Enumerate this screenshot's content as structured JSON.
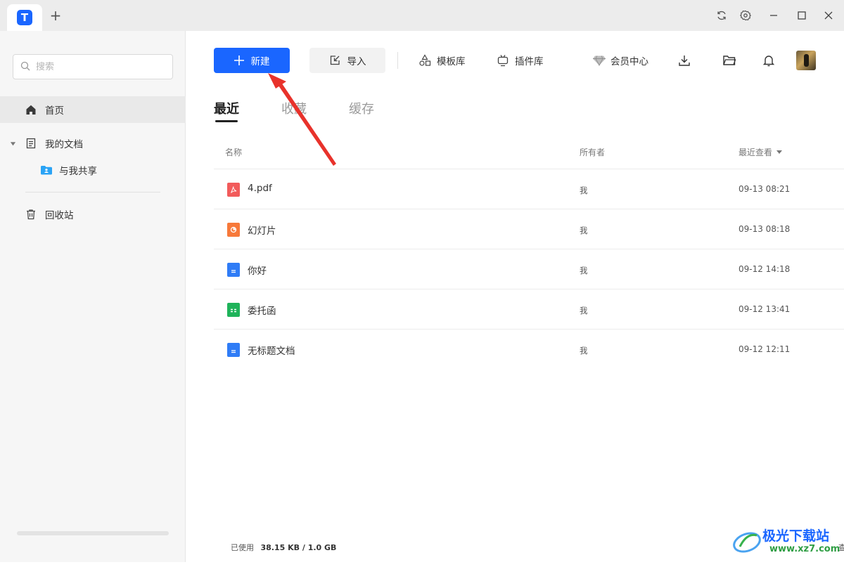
{
  "titlebar": {
    "app_logo_glyph": "T",
    "new_tab": "+"
  },
  "sidebar": {
    "search_placeholder": "搜索",
    "items": [
      {
        "label": "首页",
        "icon": "home-icon",
        "active": true
      },
      {
        "label": "我的文档",
        "icon": "document-icon",
        "expanded": true
      },
      {
        "label": "与我共享",
        "icon": "shared-folder-icon"
      },
      {
        "label": "回收站",
        "icon": "trash-icon"
      }
    ],
    "storage": {
      "label": "已使用",
      "value": "38.15 KB / 1.0 GB",
      "link": "查看",
      "used_fraction": 3.64e-05
    }
  },
  "toolbar": {
    "new_label": "新建",
    "import_label": "导入",
    "template_label": "模板库",
    "plugin_label": "插件库",
    "vip_label": "会员中心"
  },
  "tabs": [
    {
      "label": "最近",
      "active": true
    },
    {
      "label": "收藏",
      "active": false
    },
    {
      "label": "缓存",
      "active": false
    }
  ],
  "table": {
    "headers": {
      "name": "名称",
      "owner": "所有者",
      "time": "最近查看"
    },
    "rows": [
      {
        "name": "4.pdf",
        "type": "pdf",
        "owner": "我",
        "time": "09-13 08:21"
      },
      {
        "name": "幻灯片",
        "type": "slides",
        "owner": "我",
        "time": "09-13 08:18"
      },
      {
        "name": "你好",
        "type": "doc",
        "owner": "我",
        "time": "09-12 14:18"
      },
      {
        "name": "委托函",
        "type": "sheet",
        "owner": "我",
        "time": "09-12 13:41"
      },
      {
        "name": "无标题文档",
        "type": "doc",
        "owner": "我",
        "time": "09-12 12:11"
      }
    ]
  },
  "colors": {
    "accent": "#1a66ff",
    "pdf": "#f25b5b",
    "slides": "#f7793a",
    "doc": "#2f7cf6",
    "sheet": "#1fb35a",
    "annotation_arrow": "#e8322b"
  },
  "watermark": {
    "name": "极光下载站",
    "url": "www.xz7.com"
  }
}
